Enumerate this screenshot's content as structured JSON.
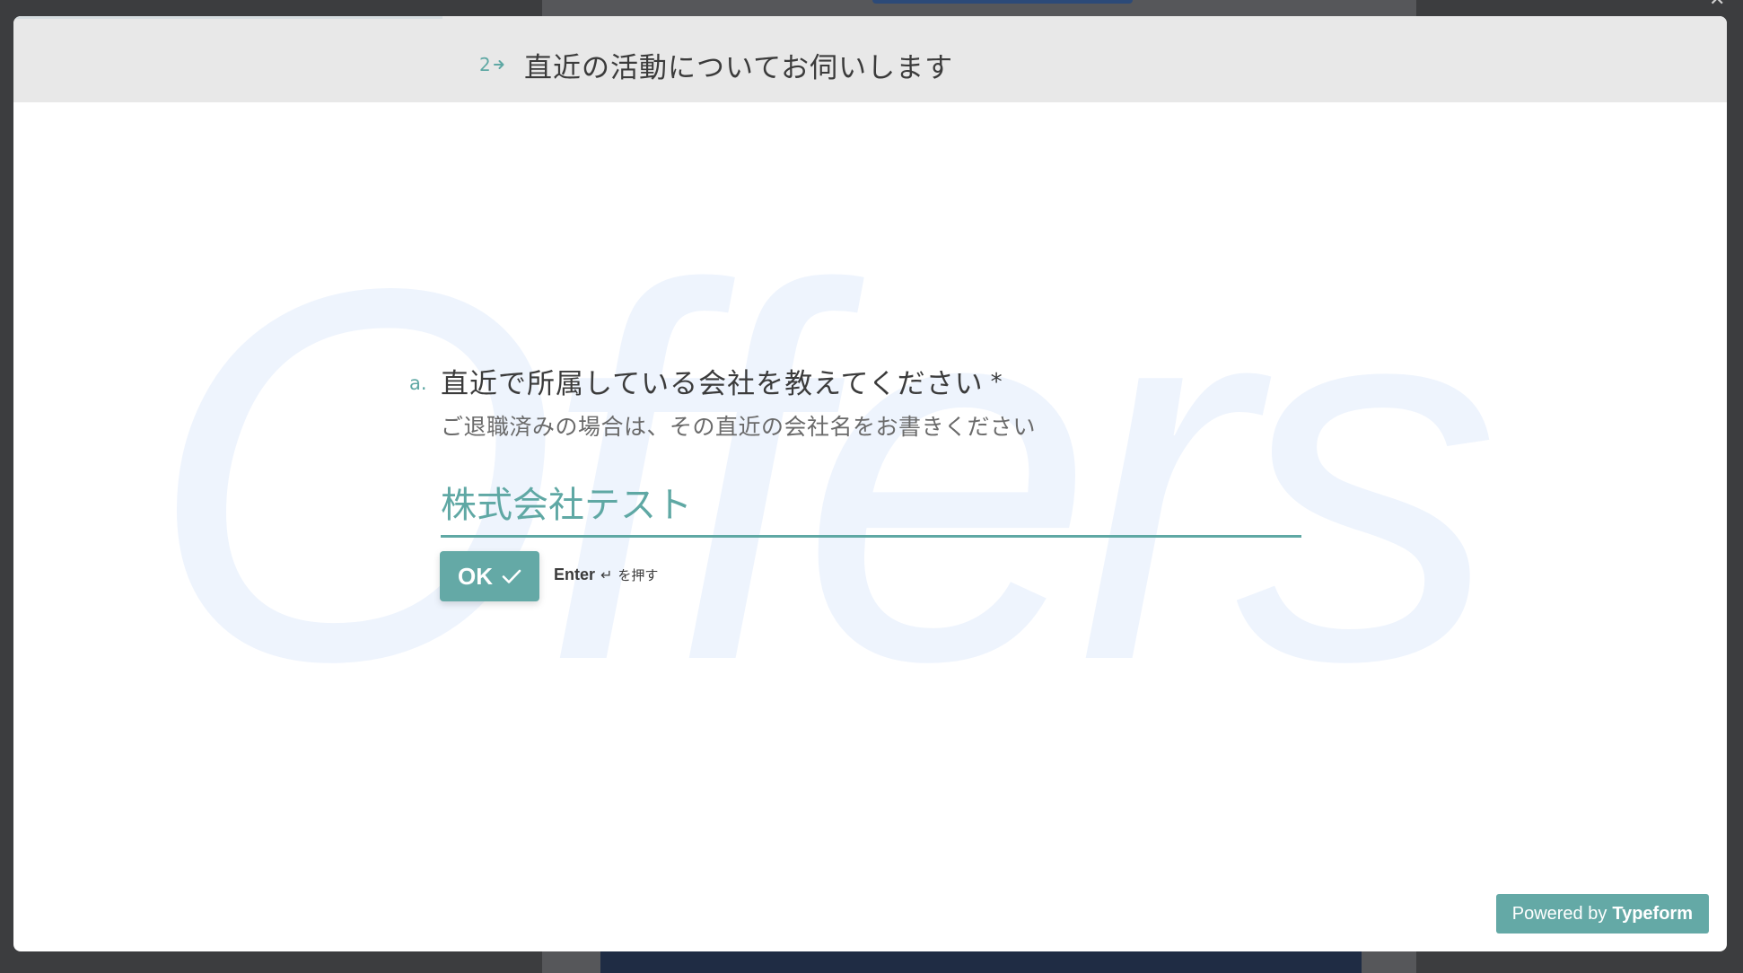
{
  "modal": {
    "group_number": "2",
    "group_title": "直近の活動についてお伺いします",
    "watermark_text": "Offers",
    "question": {
      "letter": "a.",
      "text": "直近で所属している会社を教えてください",
      "required_mark": "*",
      "description": "ご退職済みの場合は、その直近の会社名をお書きください",
      "answer_value": "株式会社テスト",
      "answer_placeholder": ""
    },
    "ok_button": {
      "label": "OK",
      "icon": "check-icon"
    },
    "enter_hint": {
      "key": "Enter",
      "return_glyph": "↵",
      "suffix": "を押す"
    },
    "branding": {
      "prefix": "Powered by",
      "brand": "Typeform"
    }
  },
  "colors": {
    "accent": "#5fa8a4",
    "button": "#64a9a6",
    "header_bg": "#e8e8e8",
    "overlay": "#3c3d3f",
    "watermark": "#eef4fd"
  }
}
